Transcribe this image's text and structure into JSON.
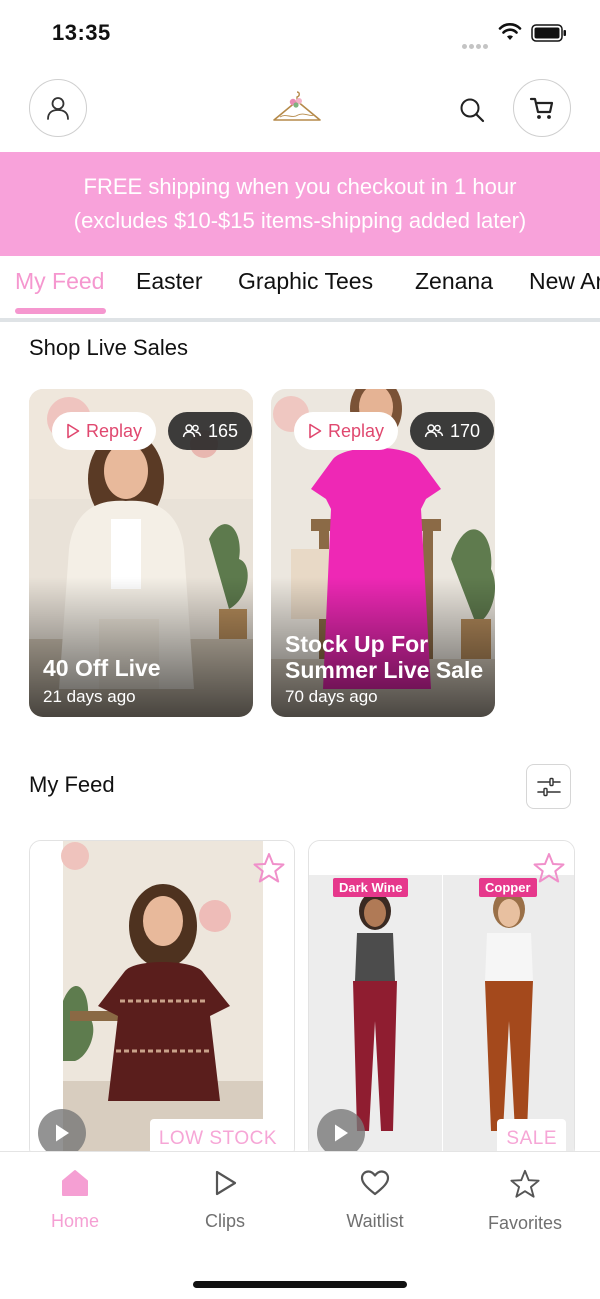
{
  "status_bar": {
    "time": "13:35"
  },
  "header": {
    "account_icon": "person-icon",
    "search_icon": "search-icon",
    "cart_icon": "cart-icon",
    "logo_icon": "hanger-logo"
  },
  "promo": {
    "line1": "FREE shipping when you checkout in 1 hour",
    "line2": "(excludes $10-$15 items-shipping added later)",
    "background": "#f8a2da"
  },
  "tabs": [
    {
      "label": "My Feed",
      "active": true
    },
    {
      "label": "Easter",
      "active": false
    },
    {
      "label": "Graphic Tees",
      "active": false
    },
    {
      "label": "Zenana",
      "active": false
    },
    {
      "label": "New Ar",
      "active": false
    }
  ],
  "live_sales": {
    "title": "Shop Live Sales",
    "cards": [
      {
        "replay_label": "Replay",
        "viewers": "165",
        "title": "40 Off Live",
        "time": "21 days ago"
      },
      {
        "replay_label": "Replay",
        "viewers": "170",
        "title_line1": "Stock Up For",
        "title_line2": "Summer Live Sale",
        "time": "70 days ago"
      }
    ]
  },
  "feed": {
    "title": "My Feed",
    "filter_icon": "sliders-icon",
    "cards": [
      {
        "badge": "LOW STOCK",
        "favorite_icon": "star-icon",
        "play_icon": "play-icon"
      },
      {
        "badge": "SALE",
        "favorite_icon": "star-icon",
        "play_icon": "play-icon",
        "color_tags": [
          "Dark Wine",
          "Copper"
        ]
      }
    ]
  },
  "bottom_nav": [
    {
      "label": "Home",
      "icon": "home-icon",
      "active": true
    },
    {
      "label": "Clips",
      "icon": "play-outline-icon",
      "active": false
    },
    {
      "label": "Waitlist",
      "icon": "heart-icon",
      "active": false
    },
    {
      "label": "Favorites",
      "icon": "star-icon",
      "active": false
    }
  ],
  "colors": {
    "accent": "#f597cf",
    "replay_text": "#e0486f",
    "tag": "#e6388c"
  }
}
